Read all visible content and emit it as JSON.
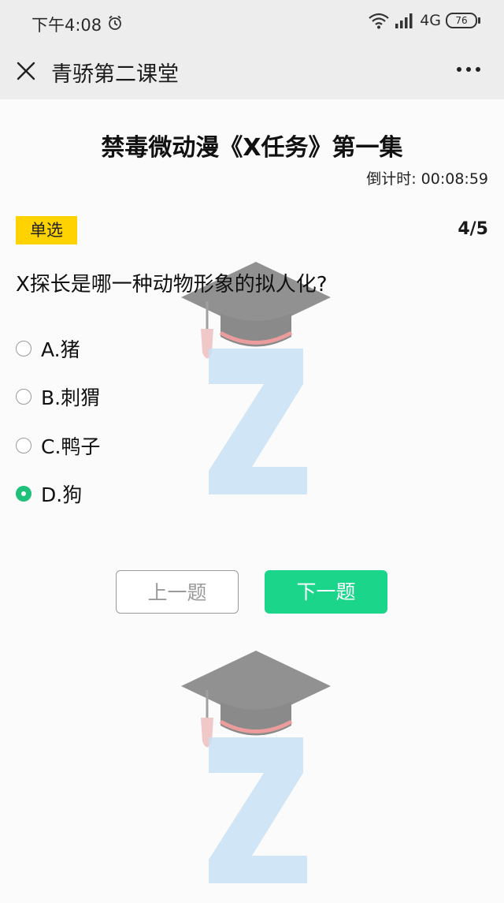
{
  "status_bar": {
    "time": "下午4:08",
    "network": "4G",
    "battery": "76"
  },
  "nav": {
    "title": "青骄第二课堂"
  },
  "quiz": {
    "title": "禁毒微动漫《X任务》第一集",
    "countdown": "倒计时: 00:08:59",
    "question_type": "单选",
    "progress": "4/5",
    "question": "X探长是哪一种动物形象的拟人化?",
    "options": [
      {
        "label": "A.猪",
        "selected": false
      },
      {
        "label": "B.刺猬",
        "selected": false
      },
      {
        "label": "C.鸭子",
        "selected": false
      },
      {
        "label": "D.狗",
        "selected": true
      }
    ],
    "prev_label": "上一题",
    "next_label": "下一题"
  },
  "colors": {
    "accent_green": "#1bd58a",
    "badge_yellow": "#ffd200",
    "bar_bg": "#ededed"
  },
  "icons": [
    "alarm-icon",
    "wifi-icon",
    "signal-icon",
    "battery-icon",
    "close-icon",
    "more-icon",
    "graduation-cap-watermark"
  ]
}
